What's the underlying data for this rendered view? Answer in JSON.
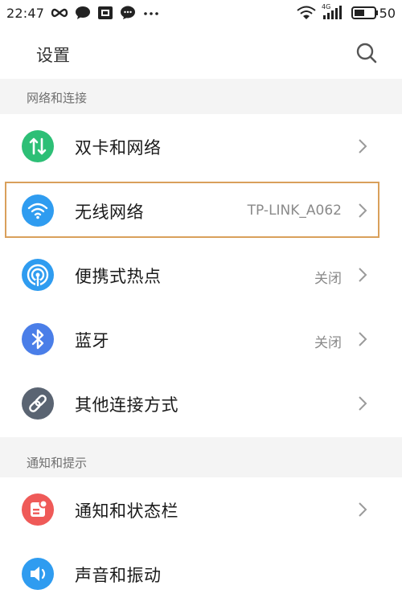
{
  "status_bar": {
    "time": "22:47",
    "battery": "50",
    "network_label": "4G"
  },
  "header": {
    "title": "设置"
  },
  "sections": [
    {
      "title": "网络和连接",
      "items": [
        {
          "label": "双卡和网络",
          "value": "",
          "icon": "dual-sim-icon",
          "color": "#2dbf76"
        },
        {
          "label": "无线网络",
          "value": "TP-LINK_A062",
          "icon": "wifi-icon",
          "color": "#2f9cf0"
        },
        {
          "label": "便携式热点",
          "value": "关闭",
          "icon": "hotspot-icon",
          "color": "#2f9cf0"
        },
        {
          "label": "蓝牙",
          "value": "关闭",
          "icon": "bluetooth-icon",
          "color": "#4a7ee8"
        },
        {
          "label": "其他连接方式",
          "value": "",
          "icon": "link-icon",
          "color": "#5a6472"
        }
      ]
    },
    {
      "title": "通知和提示",
      "items": [
        {
          "label": "通知和状态栏",
          "value": "",
          "icon": "notification-icon",
          "color": "#ef5a58"
        },
        {
          "label": "声音和振动",
          "value": "",
          "icon": "sound-icon",
          "color": "#2f9cf0"
        }
      ]
    }
  ]
}
